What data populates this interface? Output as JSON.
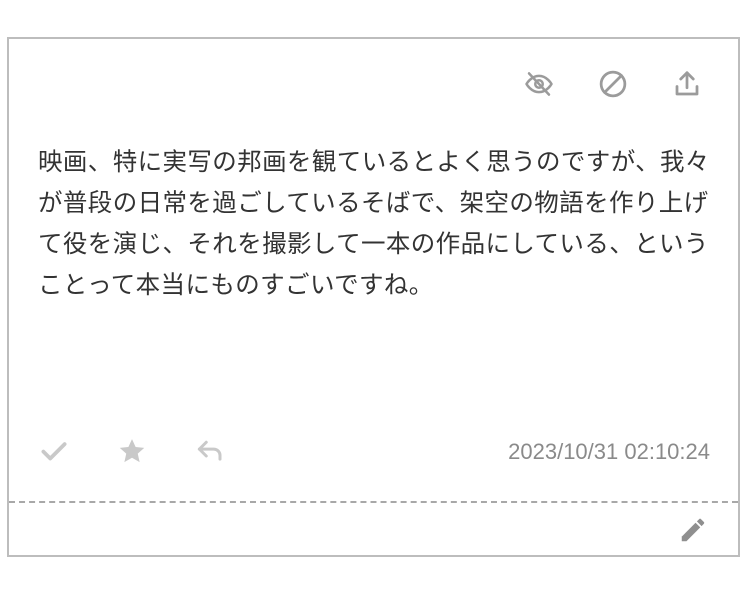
{
  "card": {
    "message": "映画、特に実写の邦画を観ているとよく思うのですが、我々が普段の日常を過ごしているそばで、架空の物語を作り上げて役を演じ、それを撮影して一本の作品にしている、ということって本当にものすごいですね。",
    "timestamp": "2023/10/31 02:10:24",
    "top_icons": [
      "eye-off-icon",
      "block-icon",
      "share-upload-icon"
    ],
    "bottom_icons": [
      "check-icon",
      "star-icon",
      "reply-icon"
    ],
    "edit_icon": "pencil-icon"
  },
  "colors": {
    "border": "#bdbdbd",
    "text": "#333333",
    "icon_dark": "#9b9b9b",
    "icon_light": "#c9c9c9",
    "timestamp": "#8a8a8a"
  }
}
